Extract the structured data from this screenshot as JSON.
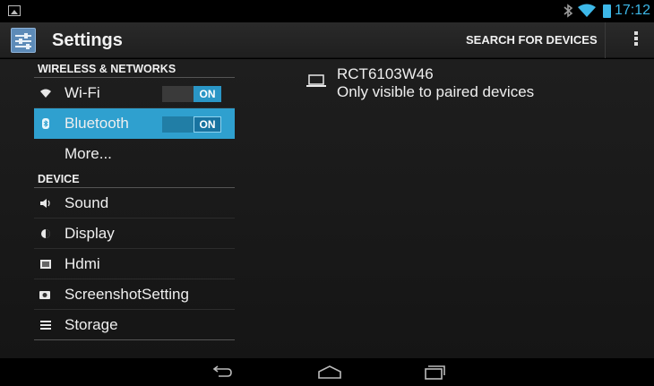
{
  "status_bar": {
    "time": "17:12",
    "icons": [
      "gallery-icon",
      "bluetooth-icon",
      "wifi-icon",
      "battery-icon"
    ],
    "accent_color": "#3db8e8"
  },
  "action_bar": {
    "title": "Settings",
    "search_label": "SEARCH FOR DEVICES",
    "overflow_icon": "overflow-menu-icon"
  },
  "left_pane": {
    "section_wireless": "WIRELESS & NETWORKS",
    "wifi": {
      "label": "Wi-Fi",
      "toggle": "ON",
      "icon": "wifi-icon"
    },
    "bluetooth": {
      "label": "Bluetooth",
      "toggle": "ON",
      "icon": "bluetooth-icon",
      "selected": true
    },
    "more": {
      "label": "More..."
    },
    "section_device": "DEVICE",
    "sound": {
      "label": "Sound",
      "icon": "sound-icon"
    },
    "display": {
      "label": "Display",
      "icon": "display-icon"
    },
    "hdmi": {
      "label": "Hdmi",
      "icon": "hdmi-icon"
    },
    "screenshot": {
      "label": "ScreenshotSetting",
      "icon": "camera-icon"
    },
    "storage": {
      "label": "Storage",
      "icon": "storage-icon"
    }
  },
  "right_pane": {
    "device_name": "RCT6103W46",
    "device_status": "Only visible to paired devices",
    "device_icon": "laptop-icon"
  },
  "nav_bar": {
    "buttons": [
      "back-icon",
      "home-icon",
      "recents-icon"
    ]
  },
  "colors": {
    "selected_bg": "#2fa0cf",
    "toggle_on": "#2a96c6"
  }
}
